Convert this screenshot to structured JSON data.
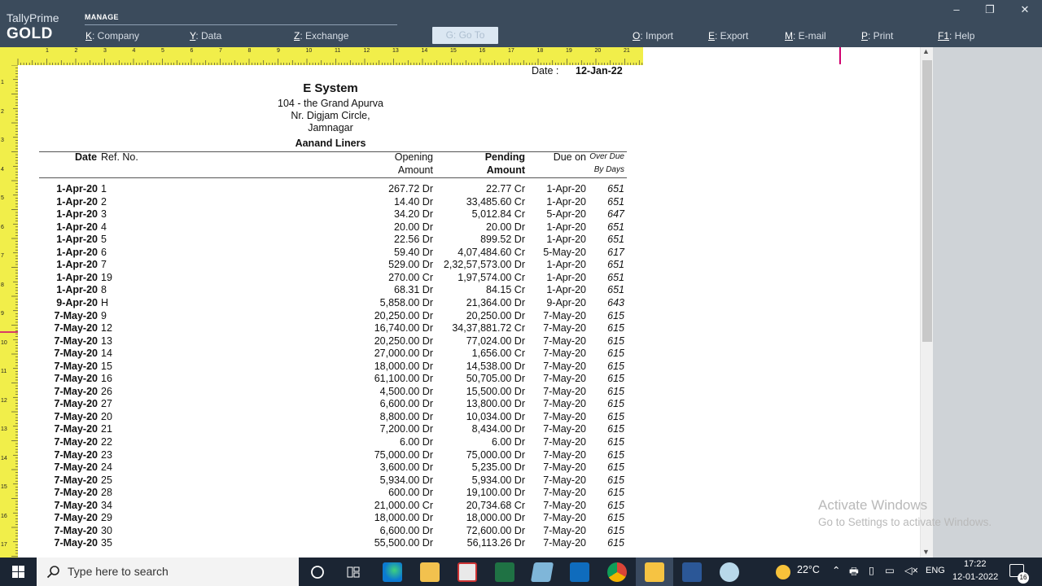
{
  "app": {
    "brand_top": "TallyPrime",
    "brand_edition": "GOLD",
    "section": "MANAGE"
  },
  "menu": [
    {
      "key": "K",
      "label": ": Company"
    },
    {
      "key": "Y",
      "label": ": Data"
    },
    {
      "key": "Z",
      "label": ": Exchange"
    },
    {
      "key": "O",
      "label": ": Import"
    },
    {
      "key": "E",
      "label": ": Export"
    },
    {
      "key": "M",
      "label": ": E-mail"
    },
    {
      "key": "P",
      "label": ": Print"
    },
    {
      "key": "F1",
      "label": ": Help"
    }
  ],
  "goto_label": "G: Go To",
  "window_controls": {
    "minimize": "–",
    "restore": "❐",
    "close": "✕"
  },
  "ruler": {
    "h": [
      "1",
      "2",
      "3",
      "4",
      "5",
      "6",
      "7",
      "8",
      "9",
      "10",
      "11",
      "12",
      "13",
      "14",
      "15",
      "16",
      "17",
      "18",
      "19",
      "20",
      "21"
    ],
    "v": [
      "1",
      "2",
      "3",
      "4",
      "5",
      "6",
      "7",
      "8",
      "9",
      "10",
      "11",
      "12",
      "13",
      "14",
      "15",
      "16",
      "17"
    ]
  },
  "report": {
    "date_label": "Date :",
    "date_value": "12-Jan-22",
    "company": "E System",
    "address": [
      "104 - the Grand Apurva",
      "Nr. Digjam Circle,",
      "Jamnagar"
    ],
    "party": "Aanand Liners",
    "headers": {
      "date": "Date",
      "ref": "Ref. No.",
      "opening1": "Opening",
      "opening2": "Amount",
      "pending1": "Pending",
      "pending2": "Amount",
      "due": "Due on",
      "over1": "Over Due",
      "over2": "By Days"
    },
    "rows": [
      {
        "date": "1-Apr-20",
        "ref": "1",
        "opening": "267.72 Dr",
        "pending": "22.77 Cr",
        "due": "1-Apr-20",
        "over": "651"
      },
      {
        "date": "1-Apr-20",
        "ref": "2",
        "opening": "14.40 Dr",
        "pending": "33,485.60 Cr",
        "due": "1-Apr-20",
        "over": "651"
      },
      {
        "date": "1-Apr-20",
        "ref": "3",
        "opening": "34.20 Dr",
        "pending": "5,012.84 Cr",
        "due": "5-Apr-20",
        "over": "647"
      },
      {
        "date": "1-Apr-20",
        "ref": "4",
        "opening": "20.00 Dr",
        "pending": "20.00 Dr",
        "due": "1-Apr-20",
        "over": "651"
      },
      {
        "date": "1-Apr-20",
        "ref": "5",
        "opening": "22.56 Dr",
        "pending": "899.52 Dr",
        "due": "1-Apr-20",
        "over": "651"
      },
      {
        "date": "1-Apr-20",
        "ref": "6",
        "opening": "59.40 Dr",
        "pending": "4,07,484.60 Cr",
        "due": "5-May-20",
        "over": "617"
      },
      {
        "date": "1-Apr-20",
        "ref": "7",
        "opening": "529.00 Dr",
        "pending": "2,32,57,573.00 Dr",
        "due": "1-Apr-20",
        "over": "651"
      },
      {
        "date": "1-Apr-20",
        "ref": "19",
        "opening": "270.00 Cr",
        "pending": "1,97,574.00 Cr",
        "due": "1-Apr-20",
        "over": "651"
      },
      {
        "date": "1-Apr-20",
        "ref": "8",
        "opening": "68.31 Dr",
        "pending": "84.15 Cr",
        "due": "1-Apr-20",
        "over": "651"
      },
      {
        "date": "9-Apr-20",
        "ref": "H",
        "opening": "5,858.00 Dr",
        "pending": "21,364.00 Dr",
        "due": "9-Apr-20",
        "over": "643"
      },
      {
        "date": "7-May-20",
        "ref": "9",
        "opening": "20,250.00 Dr",
        "pending": "20,250.00 Dr",
        "due": "7-May-20",
        "over": "615"
      },
      {
        "date": "7-May-20",
        "ref": "12",
        "opening": "16,740.00 Dr",
        "pending": "34,37,881.72 Cr",
        "due": "7-May-20",
        "over": "615"
      },
      {
        "date": "7-May-20",
        "ref": "13",
        "opening": "20,250.00 Dr",
        "pending": "77,024.00 Dr",
        "due": "7-May-20",
        "over": "615"
      },
      {
        "date": "7-May-20",
        "ref": "14",
        "opening": "27,000.00 Dr",
        "pending": "1,656.00 Cr",
        "due": "7-May-20",
        "over": "615"
      },
      {
        "date": "7-May-20",
        "ref": "15",
        "opening": "18,000.00 Dr",
        "pending": "14,538.00 Dr",
        "due": "7-May-20",
        "over": "615"
      },
      {
        "date": "7-May-20",
        "ref": "16",
        "opening": "61,100.00 Dr",
        "pending": "50,705.00 Dr",
        "due": "7-May-20",
        "over": "615"
      },
      {
        "date": "7-May-20",
        "ref": "26",
        "opening": "4,500.00 Dr",
        "pending": "15,500.00 Dr",
        "due": "7-May-20",
        "over": "615"
      },
      {
        "date": "7-May-20",
        "ref": "27",
        "opening": "6,600.00 Dr",
        "pending": "13,800.00 Dr",
        "due": "7-May-20",
        "over": "615"
      },
      {
        "date": "7-May-20",
        "ref": "20",
        "opening": "8,800.00 Dr",
        "pending": "10,034.00 Dr",
        "due": "7-May-20",
        "over": "615"
      },
      {
        "date": "7-May-20",
        "ref": "21",
        "opening": "7,200.00 Dr",
        "pending": "8,434.00 Dr",
        "due": "7-May-20",
        "over": "615"
      },
      {
        "date": "7-May-20",
        "ref": "22",
        "opening": "6.00 Dr",
        "pending": "6.00 Dr",
        "due": "7-May-20",
        "over": "615"
      },
      {
        "date": "7-May-20",
        "ref": "23",
        "opening": "75,000.00 Dr",
        "pending": "75,000.00 Dr",
        "due": "7-May-20",
        "over": "615"
      },
      {
        "date": "7-May-20",
        "ref": "24",
        "opening": "3,600.00 Dr",
        "pending": "5,235.00 Dr",
        "due": "7-May-20",
        "over": "615"
      },
      {
        "date": "7-May-20",
        "ref": "25",
        "opening": "5,934.00 Dr",
        "pending": "5,934.00 Dr",
        "due": "7-May-20",
        "over": "615"
      },
      {
        "date": "7-May-20",
        "ref": "28",
        "opening": "600.00 Dr",
        "pending": "19,100.00 Dr",
        "due": "7-May-20",
        "over": "615"
      },
      {
        "date": "7-May-20",
        "ref": "34",
        "opening": "21,000.00 Cr",
        "pending": "20,734.68 Cr",
        "due": "7-May-20",
        "over": "615"
      },
      {
        "date": "7-May-20",
        "ref": "29",
        "opening": "18,000.00 Dr",
        "pending": "18,000.00 Dr",
        "due": "7-May-20",
        "over": "615"
      },
      {
        "date": "7-May-20",
        "ref": "30",
        "opening": "6,600.00 Dr",
        "pending": "72,600.00 Dr",
        "due": "7-May-20",
        "over": "615"
      },
      {
        "date": "7-May-20",
        "ref": "35",
        "opening": "55,500.00 Dr",
        "pending": "56,113.26 Dr",
        "due": "7-May-20",
        "over": "615"
      }
    ]
  },
  "watermark": {
    "line1": "Activate Windows",
    "line2": "Go to Settings to activate Windows."
  },
  "taskbar": {
    "search_placeholder": "Type here to search",
    "weather": "22°C",
    "lang": "ENG",
    "time": "17:22",
    "date": "12-01-2022",
    "notif_count": "16",
    "icons": [
      "cortana-icon",
      "task-view-icon",
      "edge-icon",
      "file-explorer-icon",
      "calculator-icon",
      "excel-icon",
      "app-icon",
      "outlook-icon",
      "chrome-icon",
      "tally-icon",
      "word-icon",
      "paint-icon"
    ]
  },
  "colors": {
    "topbar": "#3b4b5c",
    "ruler": "#f1ee4a",
    "marker": "#d0006f",
    "taskbar": "#1b2533"
  }
}
